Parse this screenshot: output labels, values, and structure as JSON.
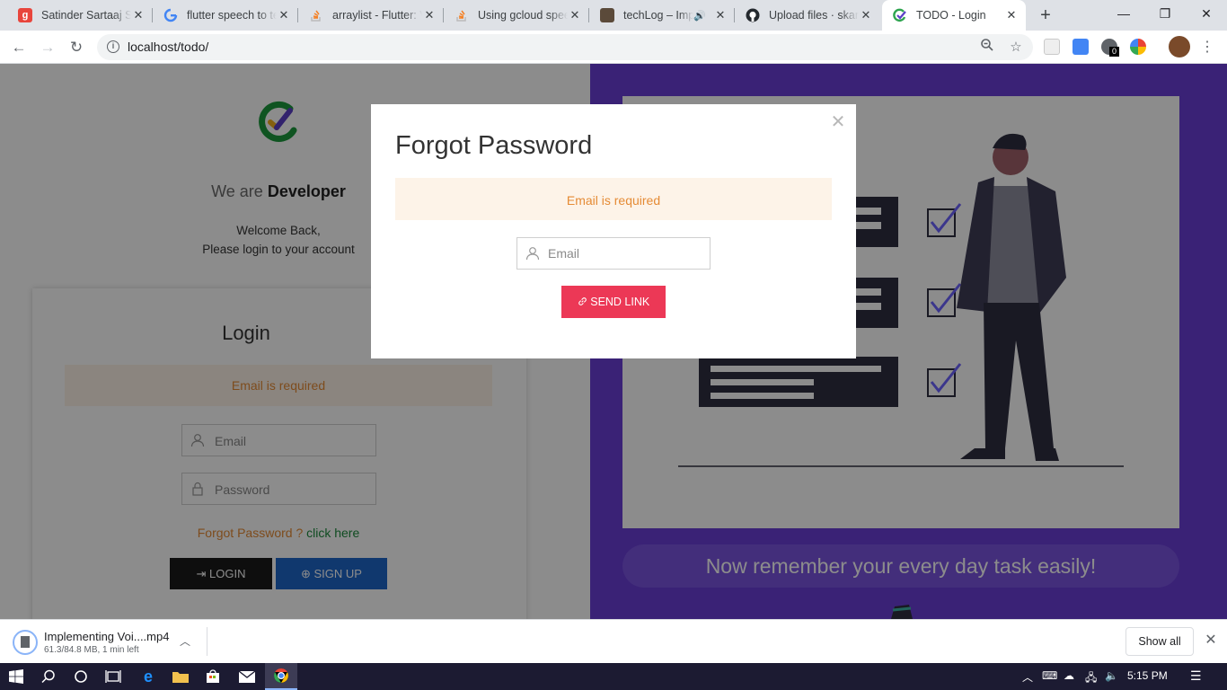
{
  "browser": {
    "tabs": [
      {
        "title": "Satinder Sartaaj Songs",
        "favicon": "g-square-icon",
        "color": "#e8453c"
      },
      {
        "title": "flutter speech to text",
        "favicon": "google-icon",
        "color": "#4285f4"
      },
      {
        "title": "arraylist - Flutter: View",
        "favicon": "stackoverflow-icon",
        "color": "#f48024"
      },
      {
        "title": "Using gcloud speech",
        "favicon": "stackoverflow-icon",
        "color": "#f48024"
      },
      {
        "title": "techLog – Implementing",
        "favicon": "techlog-icon",
        "color": "#5b4a3a",
        "audio": true
      },
      {
        "title": "Upload files · skaran",
        "favicon": "github-icon",
        "color": "#24292e"
      },
      {
        "title": "TODO - Login",
        "favicon": "todo-check-icon",
        "color": "#2ea44f",
        "active": true
      }
    ],
    "url": "localhost/todo/",
    "extension_badge": "0"
  },
  "left": {
    "tagline_prefix": "We are",
    "tagline_bold": "Developer",
    "welcome_line1": "Welcome Back,",
    "welcome_line2": "Please login to your account",
    "login_title": "Login",
    "login_error": "Email is required",
    "email_placeholder": "Email",
    "password_placeholder": "Password",
    "forgot_text": "Forgot Password ?",
    "forgot_link": "click here",
    "login_button": "LOGIN",
    "signup_button": "SIGN UP"
  },
  "right": {
    "slogan": "Now remember your every day task easily!",
    "accent": "#6a3ed8"
  },
  "modal": {
    "title": "Forgot Password",
    "error": "Email is required",
    "email_placeholder": "Email",
    "email_value": "",
    "send_button": "SEND LINK"
  },
  "downloads": {
    "filename": "Implementing Voi....mp4",
    "status": "61.3/84.8 MB, 1 min left",
    "show_all": "Show all"
  },
  "taskbar": {
    "time": "5:15 PM"
  }
}
